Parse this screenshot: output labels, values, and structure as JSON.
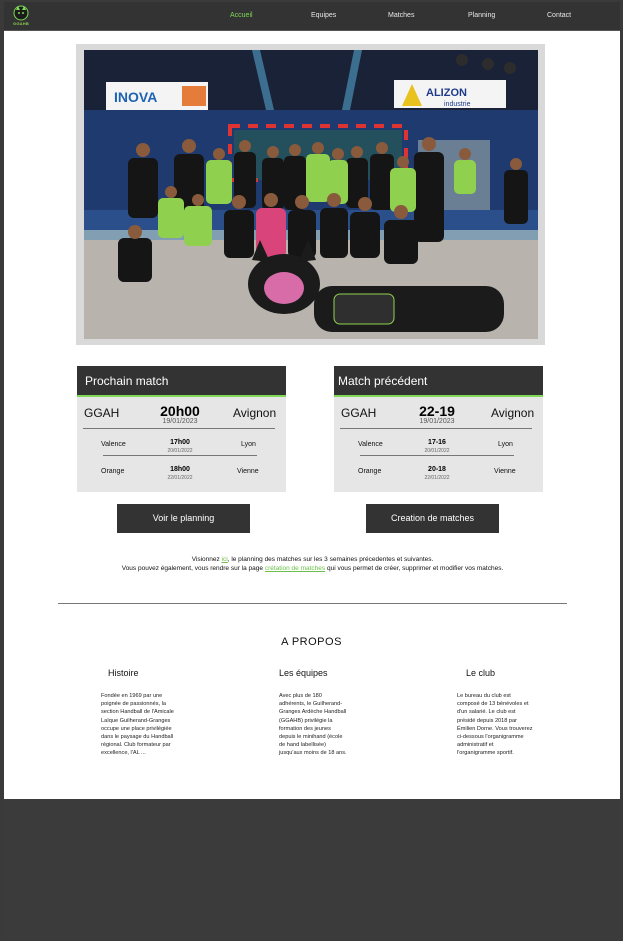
{
  "nav": {
    "logo_text": "GGAHB",
    "links": [
      "Accueil",
      "Equipes",
      "Matches",
      "Planning",
      "Contact"
    ],
    "active_index": 0
  },
  "hero": {
    "banner_left": "INOVA",
    "banner_right_brand": "ALIZON",
    "banner_right_sub": "industrie"
  },
  "next_match": {
    "title": "Prochain match",
    "home": "GGAH",
    "score": "20h00",
    "date": "19/01/2023",
    "away": "Avignon",
    "others": [
      {
        "home": "Valence",
        "score": "17h00",
        "date": "20/01/2022",
        "away": "Lyon"
      },
      {
        "home": "Orange",
        "score": "18h00",
        "date": "22/01/2022",
        "away": "Vienne"
      }
    ]
  },
  "prev_match": {
    "title": "Match précédent",
    "home": "GGAH",
    "score": "22-19",
    "date": "19/01/2023",
    "away": "Avignon",
    "others": [
      {
        "home": "Valence",
        "score": "17-16",
        "date": "20/01/2022",
        "away": "Lyon"
      },
      {
        "home": "Orange",
        "score": "20-18",
        "date": "22/01/2022",
        "away": "Vienne"
      }
    ]
  },
  "buttons": {
    "planning": "Voir le planning",
    "create": "Creation de matches"
  },
  "info": {
    "line1_pre": "Visionnez ",
    "line1_link": "ici",
    "line1_post": ", le planning des matches sur les 3 semaines précedentes et suivantes.",
    "line2_pre": "Vous pouvez également, vous rendre sur la page ",
    "line2_link": "crétation de matches",
    "line2_post": " qui vous permet de créer, supprimer et modifier vos matches."
  },
  "about": {
    "title": "A  PROPOS",
    "columns": [
      {
        "title": "Histoire",
        "text": "Fondée en 1969 par une poignée de passionnés, la section Handball de l'Amicale Laïque Guilherand-Granges occupe une place privilégiée dans le paysage du Handball régional. Club formateur par excellence, l'AL ..."
      },
      {
        "title": "Les équipes",
        "text": "Avec plus de 180 adhérents, le Guilherand-Granges Ardèche Handball (GGAHB) privilégie la formation des jeunes depuis le minihand (école de hand labellisée) jusqu'aux moins de 18 ans."
      },
      {
        "title": "Le club",
        "text": "Le bureau du club est composé de 13 bénévoles et d'un salarié. Le club est présidé depuis 2018 par Émilien Dorne. Vous trouverez ci-dessous l'organigramme administratif et l'organigramme sportif."
      }
    ]
  },
  "colors": {
    "nav_bg": "#333333",
    "accent": "#7ed957",
    "card_bg": "#e6e6e6"
  }
}
